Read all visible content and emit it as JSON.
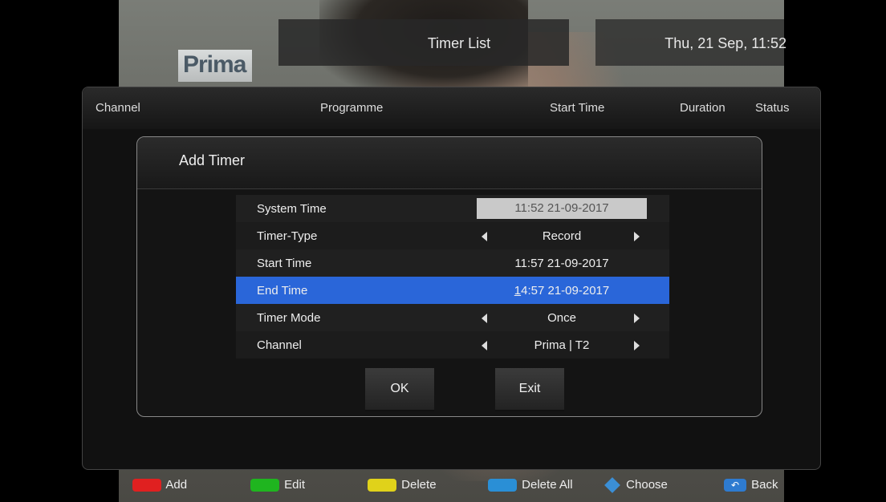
{
  "header": {
    "logo_text": "Prima",
    "title": "Timer List",
    "datetime": "Thu, 21 Sep, 11:52"
  },
  "list": {
    "columns": [
      "Channel",
      "Programme",
      "Start Time",
      "Duration",
      "Status"
    ]
  },
  "dialog": {
    "title": "Add Timer",
    "rows": [
      {
        "label": "System Time",
        "value": "11:52 21-09-2017"
      },
      {
        "label": "Timer-Type",
        "value": "Record"
      },
      {
        "label": "Start Time",
        "value": "11:57 21-09-2017"
      },
      {
        "label": "End Time",
        "value_cursor": "1",
        "value_rest": "4:57 21-09-2017"
      },
      {
        "label": "Timer Mode",
        "value": "Once"
      },
      {
        "label": "Channel",
        "value": "Prima | T2"
      }
    ],
    "ok_label": "OK",
    "exit_label": "Exit"
  },
  "keybar": {
    "add": "Add",
    "edit": "Edit",
    "delete": "Delete",
    "delete_all": "Delete All",
    "choose": "Choose",
    "back": "Back"
  },
  "colors": {
    "red": "#e02020",
    "green": "#1fb51f",
    "yellow": "#e0d21a",
    "blue": "#2a8fd6",
    "highlight": "#2a66d9"
  }
}
